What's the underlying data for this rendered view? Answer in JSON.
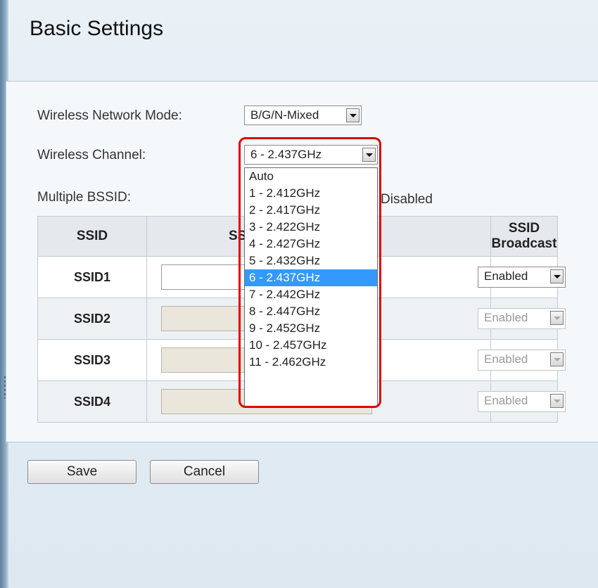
{
  "page": {
    "title": "Basic Settings"
  },
  "form": {
    "network_mode": {
      "label": "Wireless Network Mode:",
      "value": "B/G/N-Mixed"
    },
    "channel": {
      "label": "Wireless Channel:",
      "value": "6 - 2.437GHz",
      "options": [
        "Auto",
        "1 - 2.412GHz",
        "2 - 2.417GHz",
        "3 - 2.422GHz",
        "4 - 2.427GHz",
        "5 - 2.432GHz",
        "6 - 2.437GHz",
        "7 - 2.442GHz",
        "8 - 2.447GHz",
        "9 - 2.452GHz",
        "10 - 2.457GHz",
        "11 - 2.462GHz"
      ],
      "selected_index": 6
    },
    "multiple_bssid": {
      "label": "Multiple BSSID:",
      "value_text": "Disabled"
    }
  },
  "table": {
    "headers": {
      "ssid": "SSID",
      "ssid_name_partial": "SS",
      "broadcast": "SSID Broadcast"
    },
    "rows": [
      {
        "name": "SSID1",
        "broadcast": "Enabled",
        "enabled": true
      },
      {
        "name": "SSID2",
        "broadcast": "Enabled",
        "enabled": false
      },
      {
        "name": "SSID3",
        "broadcast": "Enabled",
        "enabled": false
      },
      {
        "name": "SSID4",
        "broadcast": "Enabled",
        "enabled": false
      }
    ]
  },
  "buttons": {
    "save": "Save",
    "cancel": "Cancel"
  },
  "colors": {
    "highlight": "#e00000",
    "selected_option": "#3399ff"
  }
}
